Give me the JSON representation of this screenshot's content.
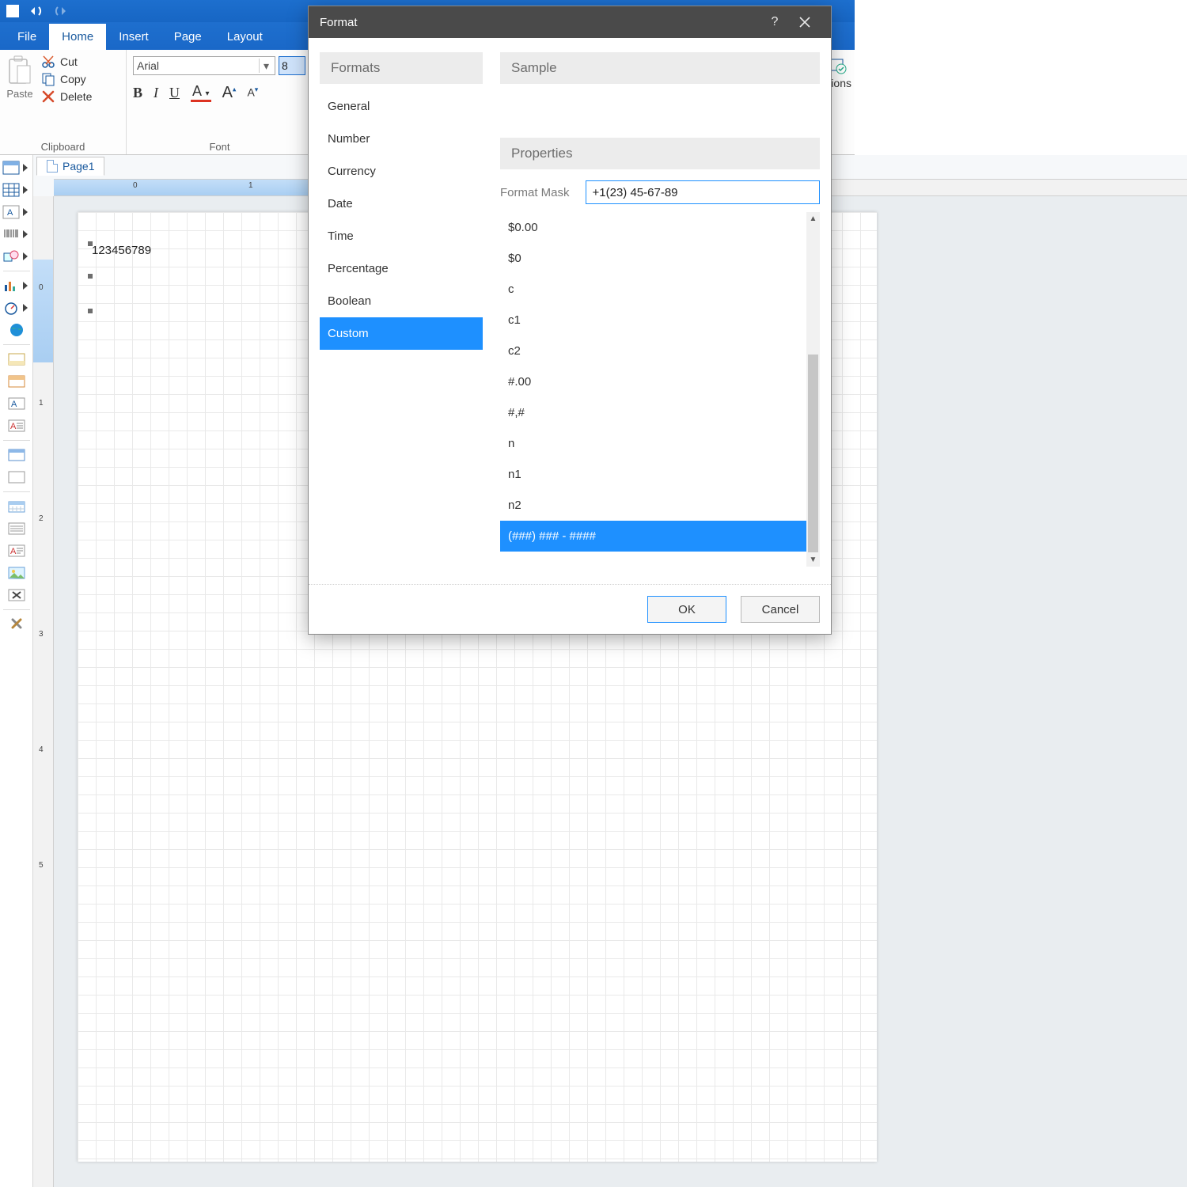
{
  "qat": {
    "save": "save",
    "undo": "undo",
    "redo": "redo"
  },
  "tabs": {
    "file": "File",
    "home": "Home",
    "insert": "Insert",
    "page": "Page",
    "layout": "Layout"
  },
  "clipboard": {
    "paste": "Paste",
    "cut": "Cut",
    "copy": "Copy",
    "delete": "Delete",
    "group": "Clipboard"
  },
  "font": {
    "family": "Arial",
    "size": "8",
    "group": "Font",
    "bold": "B",
    "italic": "I",
    "underline": "U",
    "fontcolor": "A",
    "grow": "A",
    "shrink": "A"
  },
  "ribbon_right": {
    "partial": "litions"
  },
  "pagetab": {
    "label": "Page1"
  },
  "ruler": {
    "h0": "0",
    "h1": "1",
    "v0": "0",
    "v1": "1",
    "v2": "2",
    "v3": "3",
    "v4": "4",
    "v5": "5"
  },
  "canvas": {
    "text": "123456789"
  },
  "dialog": {
    "title": "Format",
    "formats_header": "Formats",
    "sample_header": "Sample",
    "properties_header": "Properties",
    "mask_label": "Format Mask",
    "mask_value": "+1(23) 45-67-89",
    "ok": "OK",
    "cancel": "Cancel",
    "categories": [
      "General",
      "Number",
      "Currency",
      "Date",
      "Time",
      "Percentage",
      "Boolean",
      "Custom"
    ],
    "selected_category": "Custom",
    "masks": [
      "$0.00",
      "$0",
      "c",
      "c1",
      "c2",
      "#.00",
      "#,#",
      "n",
      "n1",
      "n2",
      "(###) ### - ####"
    ],
    "selected_mask": "(###) ### - ####"
  }
}
